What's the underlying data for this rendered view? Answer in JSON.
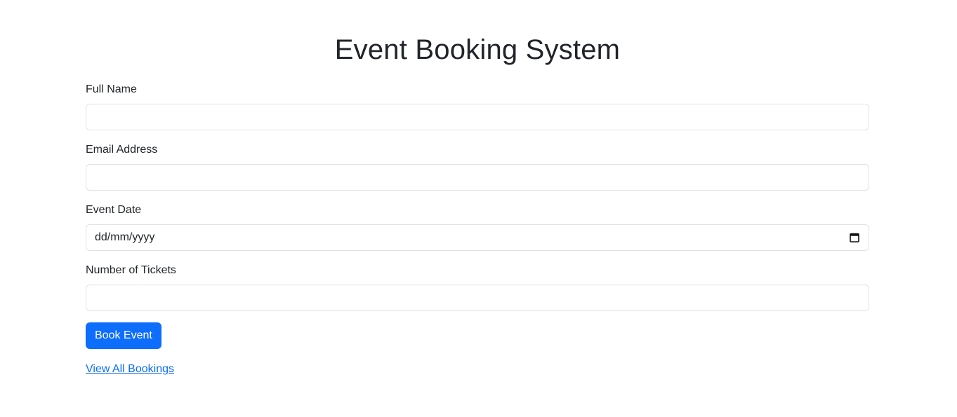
{
  "page": {
    "title": "Event Booking System"
  },
  "form": {
    "full_name": {
      "label": "Full Name",
      "value": "",
      "placeholder": ""
    },
    "email": {
      "label": "Email Address",
      "value": "",
      "placeholder": ""
    },
    "event_date": {
      "label": "Event Date",
      "display_value": "dd/mm/yyyy",
      "icon": "calendar-icon"
    },
    "tickets": {
      "label": "Number of Tickets",
      "value": "",
      "placeholder": ""
    },
    "submit_label": "Book Event"
  },
  "links": {
    "view_all": "View All Bookings"
  },
  "colors": {
    "primary": "#0d6efd",
    "text": "#212529",
    "border": "#dee2e6"
  }
}
